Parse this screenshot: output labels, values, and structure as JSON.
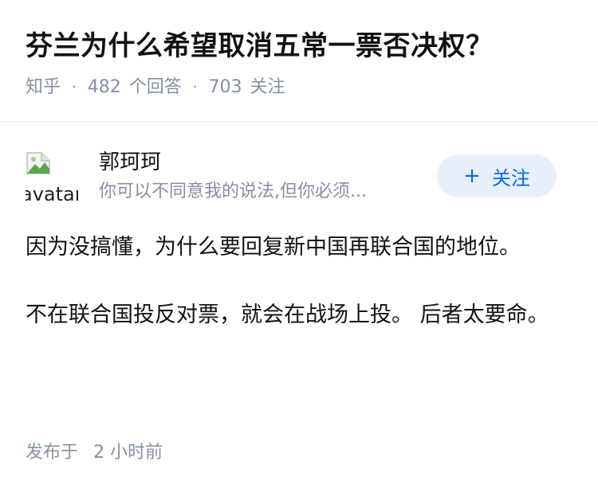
{
  "question": {
    "title": "芬兰为什么希望取消五常一票否决权？",
    "source": "知乎",
    "answer_count": "482",
    "answer_label": "个回答",
    "follow_count": "703",
    "follow_label": "关注"
  },
  "author": {
    "avatar_alt": "avatar",
    "name": "郭珂珂",
    "bio": "你可以不同意我的说法,但你必须...",
    "follow_button": "关注"
  },
  "answer": {
    "paragraphs": [
      "因为没搞懂，为什么要回复新中国再联合国的地位。",
      "不在联合国投反对票，就会在战场上投。 后者太要命。"
    ]
  },
  "footer": {
    "publish_label": "发布于",
    "publish_time": "2 小时前"
  }
}
